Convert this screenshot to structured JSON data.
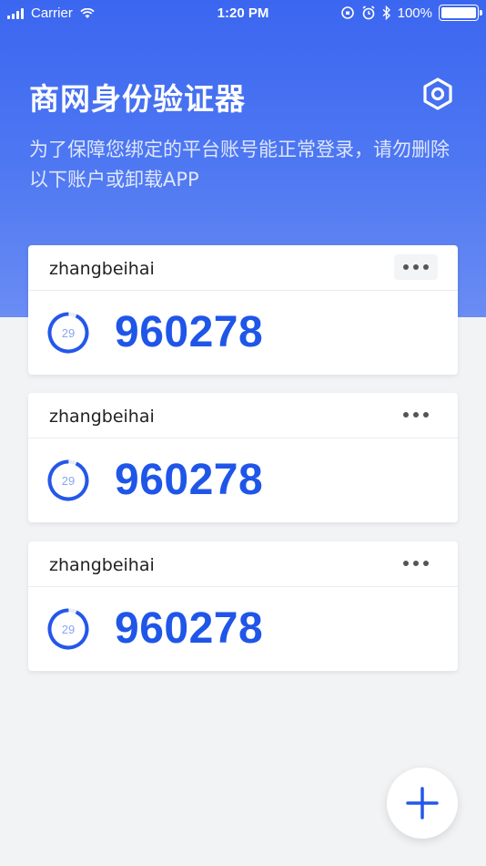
{
  "status_bar": {
    "carrier": "Carrier",
    "time": "1:20 PM",
    "battery": "100%"
  },
  "header": {
    "title": "商网身份验证器",
    "subtitle": "为了保障您绑定的平台账号能正常登录，请勿删除以下账户或卸载APP"
  },
  "accounts": [
    {
      "name": "zhangbeihai",
      "code": "960278",
      "seconds_left": "29"
    },
    {
      "name": "zhangbeihai",
      "code": "960278",
      "seconds_left": "29"
    },
    {
      "name": "zhangbeihai",
      "code": "960278",
      "seconds_left": "29"
    }
  ],
  "colors": {
    "header_gradient_start": "#3b66f0",
    "header_gradient_end": "#6a8cf3",
    "code": "#1f56e8",
    "timer_ring": "#2457ea"
  },
  "icons": {
    "settings": "hexagon-settings-icon",
    "more": "more-dots-icon",
    "add": "plus-icon"
  }
}
